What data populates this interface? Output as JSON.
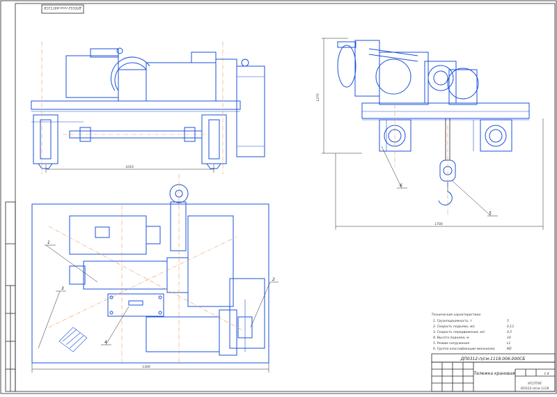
{
  "stamp": {
    "rotated_code": "ДП0312-п/см-4/ЕГ11СВ"
  },
  "dimensions": {
    "front_width": "1010",
    "side_height": "1270",
    "side_width": "1700",
    "plan_width": "1300"
  },
  "callouts": [
    "1",
    "2",
    "3",
    "4",
    "5",
    "6"
  ],
  "specs": {
    "title": "Технические характеристики",
    "rows": [
      {
        "label": "1. Грузоподъемность, т",
        "value": "5"
      },
      {
        "label": "2. Скорость подъема, м/с",
        "value": "0,13"
      },
      {
        "label": "3. Скорость передвижения, м/с",
        "value": "0,5"
      },
      {
        "label": "4. Высота подъема, м",
        "value": "10"
      },
      {
        "label": "5. Режим нагружения",
        "value": "L1"
      },
      {
        "label": "6. Группа классификации механизма",
        "value": "М2"
      }
    ]
  },
  "title_block": {
    "code": "ДП0312-п/см-1118.006.000СБ",
    "title": "Тележка крановая",
    "scale": "1:4",
    "organization": "УГСПТУЕ",
    "group": "ОО312-п/см-1118"
  }
}
